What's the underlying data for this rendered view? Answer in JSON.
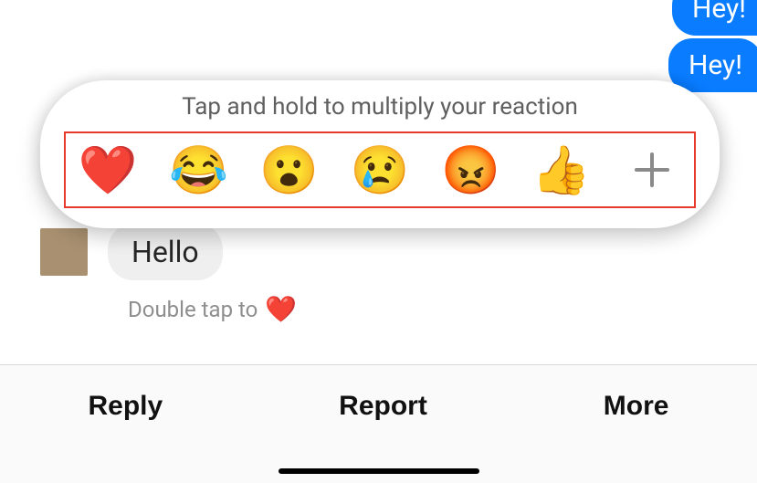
{
  "messages": {
    "outgoing_partial": "Hey!",
    "outgoing_full": "Hey!",
    "incoming": "Hello"
  },
  "reaction_overlay": {
    "hint": "Tap and hold to multiply your reaction",
    "options": {
      "heart": "❤️",
      "laugh": "😂",
      "wow": "😮",
      "sad": "😢",
      "angry": "😡",
      "like": "👍"
    }
  },
  "inline_hint": {
    "text": "Double tap to",
    "icon": "❤️"
  },
  "action_bar": {
    "reply": "Reply",
    "report": "Report",
    "more": "More"
  }
}
